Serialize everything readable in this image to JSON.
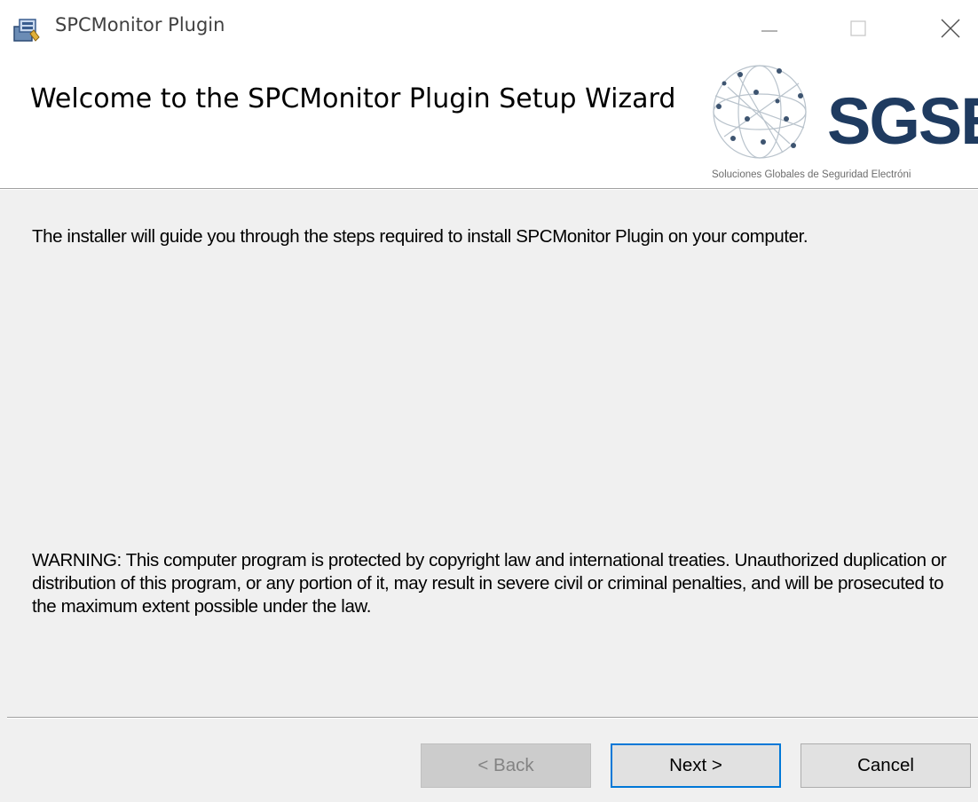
{
  "window": {
    "title": "SPCMonitor Plugin",
    "minimize_glyph": "—",
    "maximize_glyph": "☐",
    "close_glyph": "✕"
  },
  "banner": {
    "title": "Welcome to the SPCMonitor Plugin Setup Wizard",
    "logo_text": "SGSE",
    "logo_tagline": "Soluciones Globales de Seguridad Electróni",
    "logo_color": "#1f3b60"
  },
  "content": {
    "intro": "The installer will guide you through the steps required to install SPCMonitor Plugin on your computer.",
    "warning": "WARNING: This computer program is protected by copyright law and international treaties. Unauthorized duplication or distribution of this program, or any portion of it, may result in severe civil or criminal penalties, and will be prosecuted to the maximum extent possible under the law."
  },
  "buttons": {
    "back": "< Back",
    "next": "Next >",
    "cancel": "Cancel",
    "back_enabled": false,
    "focus_color": "#0078d7"
  },
  "icons": {
    "app": "installer-package-icon",
    "logo_graphic": "globe-network-icon"
  }
}
